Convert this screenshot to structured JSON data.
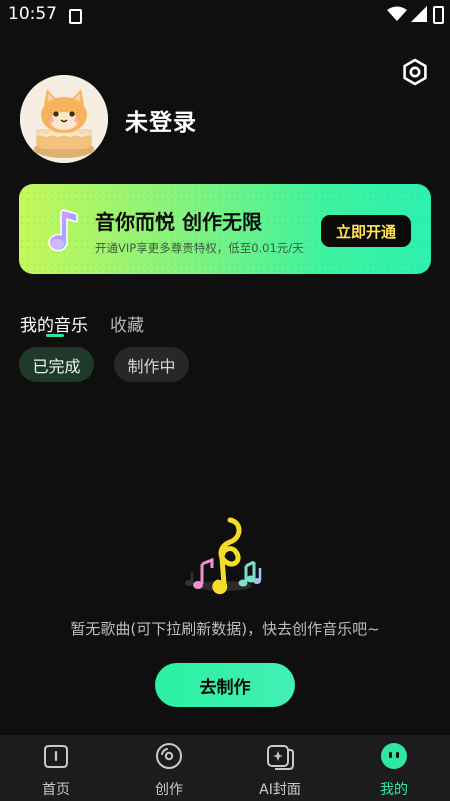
{
  "status_bar": {
    "time": "10:57"
  },
  "profile": {
    "username": "未登录"
  },
  "vip": {
    "title": "音你而悦 创作无限",
    "subtitle": "开通VIP享更多尊贵特权，低至0.01元/天",
    "button_label": "立即开通"
  },
  "tabs": [
    {
      "label": "我的音乐",
      "active": true
    },
    {
      "label": "收藏",
      "active": false
    }
  ],
  "filters": [
    {
      "label": "已完成",
      "active": true
    },
    {
      "label": "制作中",
      "active": false
    }
  ],
  "empty_state": {
    "message": "暂无歌曲(可下拉刷新数据)，快去创作音乐吧~",
    "button_label": "去制作"
  },
  "bottom_nav": [
    {
      "label": "首页",
      "icon": "home-icon",
      "active": false
    },
    {
      "label": "创作",
      "icon": "disc-icon",
      "active": false
    },
    {
      "label": "AI封面",
      "icon": "image-sparkle-icon",
      "active": false
    },
    {
      "label": "我的",
      "icon": "profile-face-icon",
      "active": true
    }
  ],
  "colors": {
    "accent": "#2fe7a2",
    "background": "#0f0f10",
    "vip_button_text": "#ffe35a"
  }
}
